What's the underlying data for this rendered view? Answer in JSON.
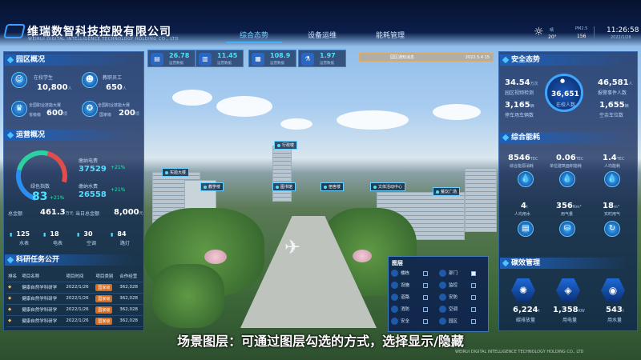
{
  "company": {
    "name": "维瑞数智科技控股有限公司",
    "name_en": "WEIRUI DIGITAL INTELLIGENCE TECHNOLOGY HOLDING CO., LTD"
  },
  "nav": {
    "tabs": [
      {
        "label": "综合态势",
        "active": true
      },
      {
        "label": "设备运维",
        "active": false
      },
      {
        "label": "能耗管理",
        "active": false
      }
    ]
  },
  "weather": {
    "condition": "晴",
    "temp": "20°",
    "pm_label": "PM2.5",
    "pm_value": "156",
    "time": "11:26:58",
    "date": "2022/1/26"
  },
  "top_cards": [
    {
      "value": "26.78",
      "label": "运营数据"
    },
    {
      "value": "11.45",
      "label": "运营数据"
    },
    {
      "value": "108.9",
      "label": "运营数据"
    },
    {
      "value": "1.97",
      "label": "运营数据"
    }
  ],
  "notice": {
    "text": "园区通知消息",
    "date": "2022.5.4 15"
  },
  "park_overview": {
    "title": "园区概况",
    "students_label": "在校学生",
    "students_value": "10,800",
    "students_unit": "人",
    "staff_label": "教职员工",
    "staff_value": "650",
    "staff_unit": "人",
    "award1_label": "全国职业技能大赛",
    "award1_sub": "省级级",
    "award1_value": "600",
    "award1_unit": "项",
    "award2_label": "全国职业技能大赛",
    "award2_sub": "国家级",
    "award2_value": "200",
    "award2_unit": "项"
  },
  "operations": {
    "title": "运营概况",
    "green_label": "绿色指数",
    "green_value": "83",
    "green_change": "+21%",
    "elec_label": "缴纳电费",
    "elec_value": "37529",
    "elec_change": "+21%",
    "water_label": "缴纳水费",
    "water_value": "26558",
    "water_change": "+21%",
    "total_label": "总金额",
    "total_value": "461.3",
    "total_unit": "万元",
    "today_label": "当日总金额",
    "today_value": "8,000",
    "today_unit": "元",
    "items": [
      {
        "value": "125",
        "label": "水表"
      },
      {
        "value": "18",
        "label": "电表"
      },
      {
        "value": "30",
        "label": "空调"
      },
      {
        "value": "84",
        "label": "路灯"
      }
    ]
  },
  "research": {
    "title": "科研任务公开",
    "headers": [
      "排名",
      "项目名称",
      "项目时间",
      "项目类别",
      "合作经营"
    ],
    "rows": [
      {
        "name": "健康自然学科研学",
        "date": "2022/1/26",
        "type": "国家级",
        "price": "362,028"
      },
      {
        "name": "健康自然学科研学",
        "date": "2022/1/26",
        "type": "国家级",
        "price": "362,028"
      },
      {
        "name": "健康自然学科研学",
        "date": "2022/1/26",
        "type": "国家级",
        "price": "362,028"
      },
      {
        "name": "健康自然学科研学",
        "date": "2022/1/26",
        "type": "国家级",
        "price": "362,028"
      }
    ]
  },
  "markers": [
    "行政楼",
    "实验大楼",
    "教学楼",
    "图书馆",
    "宿舍楼",
    "文体活动中心",
    "餐饮广场"
  ],
  "layers": {
    "title": "图层",
    "items": [
      {
        "label": "楼栋",
        "checked": false
      },
      {
        "label": "部门",
        "checked": true
      },
      {
        "label": "设施",
        "checked": false
      },
      {
        "label": "监控",
        "checked": false
      },
      {
        "label": "道路",
        "checked": false
      },
      {
        "label": "安防",
        "checked": false
      },
      {
        "label": "消防",
        "checked": false
      },
      {
        "label": "空调",
        "checked": false
      },
      {
        "label": "安全",
        "checked": false
      },
      {
        "label": "园区",
        "checked": false
      }
    ]
  },
  "security": {
    "title": "安全态势",
    "visits_value": "34.54",
    "visits_unit": "万次",
    "visits_label": "园区视频检测",
    "center_value": "36,651",
    "center_label": "在校人数",
    "alarm_value": "46,581",
    "alarm_unit": "人",
    "alarm_label": "报警事件人数",
    "parking_value": "3,165",
    "parking_unit": "辆",
    "parking_label": "停车场车辆数",
    "empty_value": "1,655",
    "empty_unit": "辆",
    "empty_label": "空余车位数"
  },
  "energy": {
    "title": "综合能耗",
    "row1": [
      {
        "value": "8546",
        "unit": "TEC",
        "label": "综合能源消耗"
      },
      {
        "value": "0.06",
        "unit": "TEC",
        "label": "单位建筑面积能耗"
      },
      {
        "value": "1.4",
        "unit": "TEC",
        "label": "人均能耗"
      }
    ],
    "row2": [
      {
        "value": "4",
        "unit": "t",
        "label": "人均用水"
      },
      {
        "value": "356",
        "unit": "Nm³",
        "label": "用气量"
      },
      {
        "value": "18",
        "unit": "m³",
        "label": "实时用气"
      }
    ]
  },
  "carbon": {
    "title": "碳效管理",
    "items": [
      {
        "value": "6,224",
        "unit": "t",
        "label": "碳排放量"
      },
      {
        "value": "1,358",
        "unit": "KW",
        "label": "用电量"
      },
      {
        "value": "543",
        "unit": "t",
        "label": "用水量"
      }
    ]
  },
  "caption": "场景图层：可通过图层勾选的方式，选择显示/隐藏",
  "watermark": "WEIRUI DIGITAL INTELLIGENCE TECHNOLOGY HOLDING CO., LTD"
}
